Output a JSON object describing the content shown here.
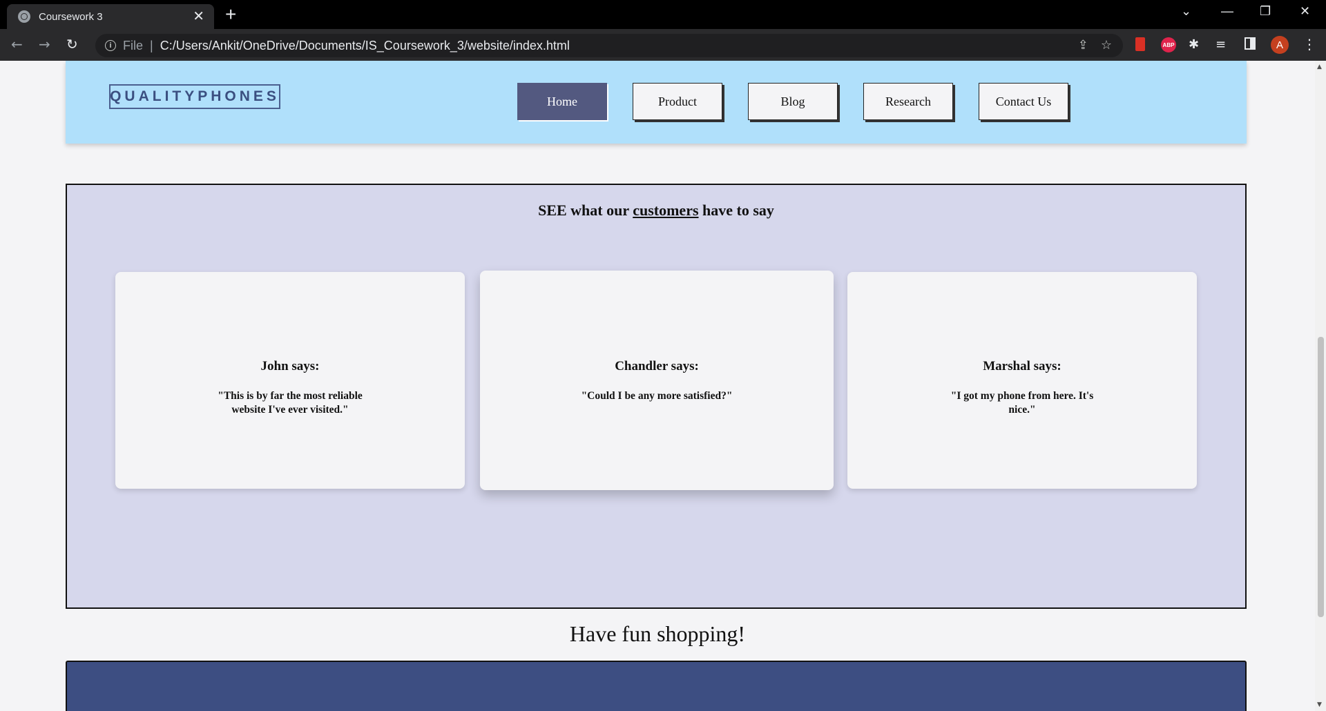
{
  "browser": {
    "tab_title": "Coursework 3",
    "tab_close": "✕",
    "new_tab": "+",
    "scheme_label": "File",
    "separator": "|",
    "url": "C:/Users/Ankit/OneDrive/Documents/IS_Coursework_3/website/index.html",
    "avatar_letter": "A",
    "abp_label": "ABP",
    "window_controls": {
      "tab_search": "⌄",
      "minimize": "—",
      "restore": "❐",
      "close": "✕"
    },
    "nav": {
      "back": "←",
      "forward": "→",
      "reload": "↻"
    },
    "omni_icons": {
      "share": "⇪",
      "star": "☆"
    }
  },
  "site": {
    "logo": "QUALITYPHONES",
    "nav": [
      "Home",
      "Product",
      "Blog",
      "Research",
      "Contact Us"
    ],
    "active_nav": "Home",
    "testimonials": {
      "title_prefix": "SEE what our ",
      "title_link": "customers",
      "title_suffix": " have to say",
      "cards": [
        {
          "name": "John says:",
          "quote": "\"This is by far the most reliable website I've ever visited.\""
        },
        {
          "name": "Chandler says:",
          "quote": "\"Could I be any more satisfied?\""
        },
        {
          "name": "Marshal says:",
          "quote": "\"I got my phone from here. It's nice.\""
        }
      ]
    },
    "tagline": "Have fun shopping!"
  },
  "colors": {
    "header_bg": "#b0e0fb",
    "active_nav_bg": "#535980",
    "testimonials_bg": "#d6d7ec",
    "footer_bg": "#3d4e82"
  }
}
